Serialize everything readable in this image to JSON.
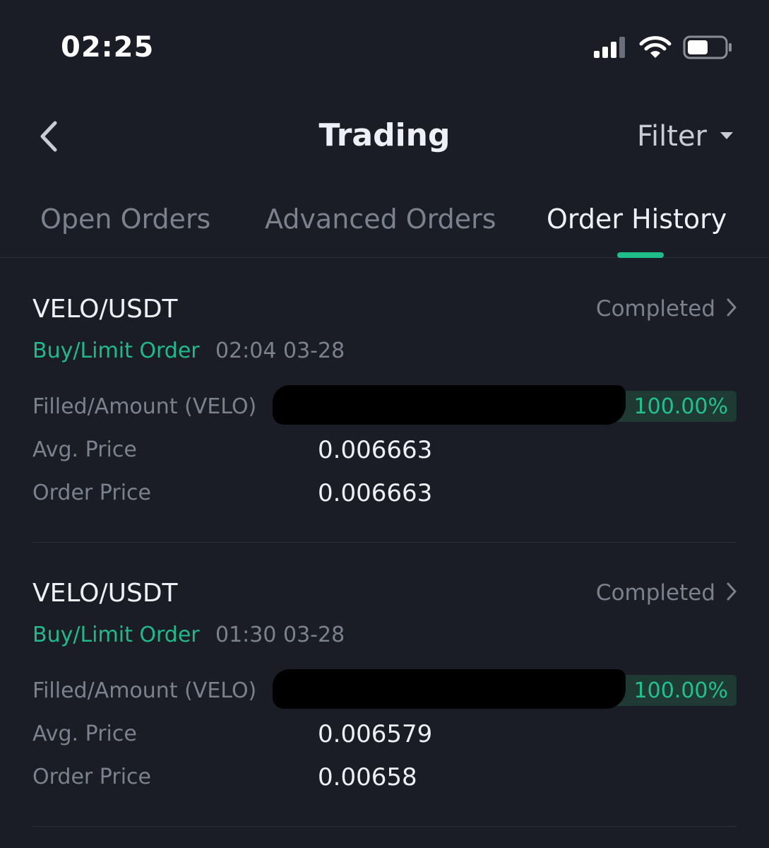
{
  "status_bar": {
    "time": "02:25"
  },
  "header": {
    "title": "Trading",
    "filter_label": "Filter"
  },
  "tabs": [
    {
      "label": "Open Orders",
      "active": false
    },
    {
      "label": "Advanced Orders",
      "active": false
    },
    {
      "label": "Order History",
      "active": true
    }
  ],
  "colors": {
    "background": "#1a1d26",
    "accent_green": "#22b98a",
    "muted_text": "#7d818e"
  },
  "orders": [
    {
      "pair": "VELO/USDT",
      "status": "Completed",
      "order_type": "Buy/Limit Order",
      "time": "02:04 03-28",
      "filled_label": "Filled/Amount (VELO)",
      "filled_percent": "100.00%",
      "avg_price_label": "Avg. Price",
      "avg_price": "0.006663",
      "order_price_label": "Order Price",
      "order_price": "0.006663"
    },
    {
      "pair": "VELO/USDT",
      "status": "Completed",
      "order_type": "Buy/Limit Order",
      "time": "01:30 03-28",
      "filled_label": "Filled/Amount (VELO)",
      "filled_percent": "100.00%",
      "avg_price_label": "Avg. Price",
      "avg_price": "0.006579",
      "order_price_label": "Order Price",
      "order_price": "0.00658"
    }
  ]
}
